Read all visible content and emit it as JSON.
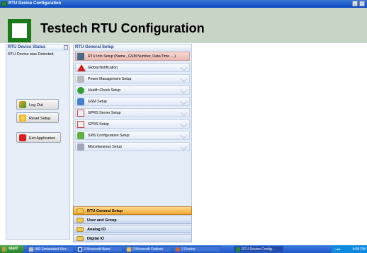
{
  "window": {
    "title": "RTU Device Configuration",
    "minimize_glyph": "_",
    "maximize_glyph": "□"
  },
  "header": {
    "title": "Testech RTU Configuration",
    "logo_icon": "green-square-logo"
  },
  "left_panel": {
    "title": "RTU Device Status",
    "status_text": "RTU Device was Detected.",
    "buttons": [
      {
        "label": "Log Out",
        "icon": "logout-arrow-icon"
      },
      {
        "label": "Reset Setup",
        "icon": "reset-arrow-icon"
      },
      {
        "label": "Exit Application",
        "icon": "power-icon"
      }
    ]
  },
  "main_panel": {
    "title": "RTU General Setup",
    "items": [
      {
        "label": "RTU Info Setup (Name , GSM Number, Date/Time ....)",
        "icon": "rtu-device-icon",
        "active": true
      },
      {
        "label": "Global Notification",
        "icon": "warning-icon"
      },
      {
        "label": "Power Management Setup",
        "icon": "power-plug-icon"
      },
      {
        "label": "Health Check Setup",
        "icon": "check-icon"
      },
      {
        "label": "GSM Setup",
        "icon": "gsm-icon"
      },
      {
        "label": "GPRS Server Setup",
        "icon": "antenna-icon"
      },
      {
        "label": "GPRS Setup",
        "icon": "antenna-icon"
      },
      {
        "label": "SMS Configuration Setup",
        "icon": "sms-icon"
      },
      {
        "label": "Miscellaneous Setup",
        "icon": "tools-icon"
      }
    ]
  },
  "nav_sections": [
    {
      "label": "RTU General Setup",
      "active": true
    },
    {
      "label": "User and Group"
    },
    {
      "label": "Analog IO"
    },
    {
      "label": "Digital IO"
    }
  ],
  "taskbar": {
    "start_label": "start",
    "tasks": [
      {
        "label": "IAR Embedded Wor..."
      },
      {
        "label": "2 Microsoft Word"
      },
      {
        "label": "2 Microsoft Outlook"
      },
      {
        "label": "2 Firefox"
      },
      {
        "label": "RTU Device Config..."
      }
    ],
    "clock": "4:08 PM"
  },
  "colors": {
    "header_bg": "#c8d4c5",
    "logo_green": "#1a7a1a",
    "active_item": "#e8b8b0",
    "active_section": "#f0a830"
  }
}
